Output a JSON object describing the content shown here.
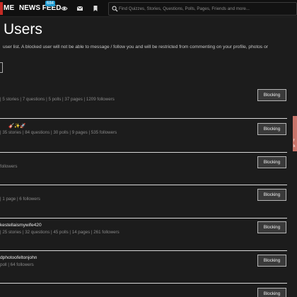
{
  "nav": {
    "me_label": "ME",
    "newsfeed_label": "NEWS FEED",
    "newsfeed_badge": "684",
    "icons": [
      "eye-icon",
      "mail-icon",
      "bookmark-icon"
    ]
  },
  "search": {
    "placeholder": "Find Quizzes, Stories, Questions, Polls, Pages, Friends and more..."
  },
  "page": {
    "title": "Users",
    "description": "user list. A blocked user will not be able to message / follow you and will be restricted from commenting on your profile, photos or"
  },
  "users": [
    {
      "name": "",
      "stats": "| 5 stories | 7 questions | 5 polls | 37 pages | 1209 followers",
      "button": "Blocking"
    },
    {
      "name": "🎸✨🚀",
      "stats": "| 35 stories | 84 questions | 30 polls | 9 pages | 535 followers",
      "button": "Blocking"
    },
    {
      "name": "",
      "stats": "followers",
      "button": "Blocking"
    },
    {
      "name": "",
      "stats": "| 1 page | 6 followers",
      "button": "Blocking"
    },
    {
      "name": "kestellaismywife420",
      "stats": "| 25 stories | 32 questions | 45 polls | 14 pages | 261 followers",
      "button": "Blocking"
    },
    {
      "name": "dphotoofeltonjohn",
      "stats": "poll | 64 followers",
      "button": "Blocking"
    },
    {
      "name": "",
      "stats": "",
      "button": "Blocking"
    }
  ],
  "side_tab": {
    "letters": [
      "f",
      "k"
    ]
  },
  "colors": {
    "accent_red": "#c52a24",
    "badge_blue": "#1e9bd2",
    "background": "#1c1c1c"
  }
}
